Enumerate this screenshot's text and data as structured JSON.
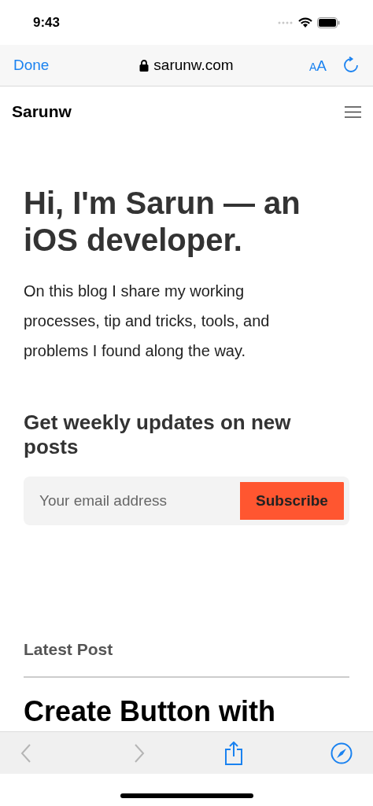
{
  "status_bar": {
    "time": "9:43"
  },
  "browser_bar": {
    "done": "Done",
    "url": "sarunw.com",
    "text_size": "AA"
  },
  "site_header": {
    "title": "Sarunw"
  },
  "hero": {
    "title": "Hi, I'm Sarun — an iOS developer.",
    "intro": "On this blog I share my working processes, tip and tricks, tools, and problems I found along the way."
  },
  "newsletter": {
    "heading": "Get weekly updates on new posts",
    "email": {
      "placeholder": "Your email address"
    },
    "button": "Subscribe"
  },
  "latest": {
    "label": "Latest Post",
    "post_title": "Create Button with"
  },
  "toolbar": {
    "items": [
      {
        "kind": "back",
        "disabled": true
      },
      {
        "kind": "forward",
        "disabled": true
      },
      {
        "kind": "share",
        "disabled": false
      },
      {
        "kind": "compass",
        "disabled": false
      }
    ]
  }
}
